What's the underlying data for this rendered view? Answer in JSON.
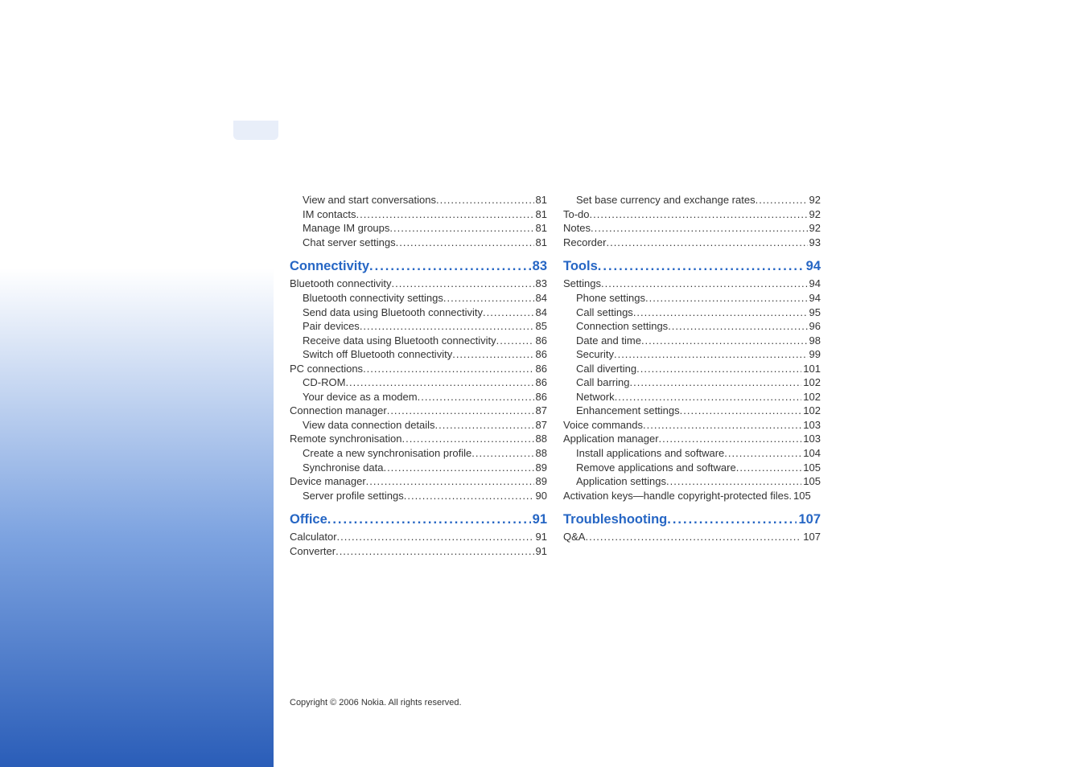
{
  "copyright": "Copyright © 2006 Nokia. All rights reserved.",
  "left": [
    {
      "t": "item",
      "ind": 1,
      "label": "View and start conversations",
      "pg": "81"
    },
    {
      "t": "item",
      "ind": 1,
      "label": "IM contacts",
      "pg": "81"
    },
    {
      "t": "item",
      "ind": 1,
      "label": "Manage IM groups",
      "pg": "81"
    },
    {
      "t": "item",
      "ind": 1,
      "label": "Chat server settings",
      "pg": "81"
    },
    {
      "t": "section",
      "label": "Connectivity",
      "pg": "83"
    },
    {
      "t": "item",
      "ind": 0,
      "label": "Bluetooth connectivity",
      "pg": "83"
    },
    {
      "t": "item",
      "ind": 1,
      "label": "Bluetooth connectivity settings",
      "pg": "84"
    },
    {
      "t": "item",
      "ind": 1,
      "label": "Send data using Bluetooth connectivity",
      "pg": "84"
    },
    {
      "t": "item",
      "ind": 1,
      "label": "Pair devices",
      "pg": "85"
    },
    {
      "t": "item",
      "ind": 1,
      "label": "Receive data using Bluetooth connectivity",
      "pg": "86"
    },
    {
      "t": "item",
      "ind": 1,
      "label": "Switch off Bluetooth connectivity",
      "pg": "86"
    },
    {
      "t": "item",
      "ind": 0,
      "label": "PC connections",
      "pg": "86"
    },
    {
      "t": "item",
      "ind": 1,
      "label": "CD-ROM",
      "pg": "86"
    },
    {
      "t": "item",
      "ind": 1,
      "label": "Your device as a modem",
      "pg": "86"
    },
    {
      "t": "item",
      "ind": 0,
      "label": "Connection manager",
      "pg": "87"
    },
    {
      "t": "item",
      "ind": 1,
      "label": "View data connection details",
      "pg": "87"
    },
    {
      "t": "item",
      "ind": 0,
      "label": "Remote synchronisation",
      "pg": "88"
    },
    {
      "t": "item",
      "ind": 1,
      "label": "Create a new synchronisation profile",
      "pg": "88"
    },
    {
      "t": "item",
      "ind": 1,
      "label": "Synchronise data",
      "pg": "89"
    },
    {
      "t": "item",
      "ind": 0,
      "label": "Device manager",
      "pg": "89"
    },
    {
      "t": "item",
      "ind": 1,
      "label": "Server profile settings",
      "pg": "90"
    },
    {
      "t": "section",
      "label": "Office",
      "pg": "91"
    },
    {
      "t": "item",
      "ind": 0,
      "label": "Calculator",
      "pg": "91"
    },
    {
      "t": "item",
      "ind": 0,
      "label": "Converter",
      "pg": "91"
    }
  ],
  "right": [
    {
      "t": "item",
      "ind": 1,
      "label": "Set base currency and exchange rates",
      "pg": "92"
    },
    {
      "t": "item",
      "ind": 0,
      "label": "To-do",
      "pg": "92"
    },
    {
      "t": "item",
      "ind": 0,
      "label": "Notes",
      "pg": "92"
    },
    {
      "t": "item",
      "ind": 0,
      "label": "Recorder",
      "pg": "93"
    },
    {
      "t": "section",
      "label": "Tools",
      "pg": "94"
    },
    {
      "t": "item",
      "ind": 0,
      "label": "Settings",
      "pg": "94"
    },
    {
      "t": "item",
      "ind": 1,
      "label": "Phone settings",
      "pg": "94"
    },
    {
      "t": "item",
      "ind": 1,
      "label": "Call settings",
      "pg": "95"
    },
    {
      "t": "item",
      "ind": 1,
      "label": "Connection settings",
      "pg": "96"
    },
    {
      "t": "item",
      "ind": 1,
      "label": "Date and time",
      "pg": "98"
    },
    {
      "t": "item",
      "ind": 1,
      "label": "Security",
      "pg": "99"
    },
    {
      "t": "item",
      "ind": 1,
      "label": "Call diverting",
      "pg": "101"
    },
    {
      "t": "item",
      "ind": 1,
      "label": "Call barring",
      "pg": "102"
    },
    {
      "t": "item",
      "ind": 1,
      "label": "Network",
      "pg": "102"
    },
    {
      "t": "item",
      "ind": 1,
      "label": "Enhancement settings",
      "pg": "102"
    },
    {
      "t": "item",
      "ind": 0,
      "label": "Voice commands",
      "pg": "103"
    },
    {
      "t": "item",
      "ind": 0,
      "label": "Application manager",
      "pg": "103"
    },
    {
      "t": "item",
      "ind": 1,
      "label": "Install applications and software",
      "pg": "104"
    },
    {
      "t": "item",
      "ind": 1,
      "label": "Remove applications and software",
      "pg": "105"
    },
    {
      "t": "item",
      "ind": 1,
      "label": "Application settings",
      "pg": "105"
    },
    {
      "t": "item",
      "ind": 0,
      "label": "Activation keys—handle copyright-protected files",
      "pg": "105",
      "nodots": true
    },
    {
      "t": "section",
      "label": "Troubleshooting",
      "pg": " 107"
    },
    {
      "t": "item",
      "ind": 0,
      "label": "Q&A",
      "pg": "107"
    }
  ]
}
